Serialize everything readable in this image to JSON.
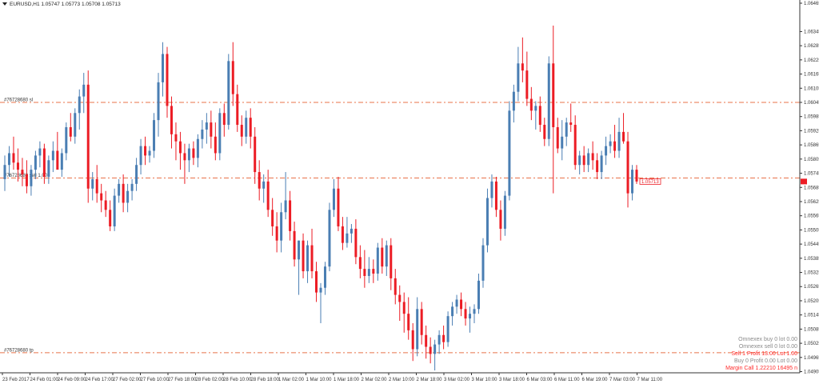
{
  "header": {
    "symbol_line": "EURUSD,H1  1.05747 1.05773 1.05708 1.05713"
  },
  "colors": {
    "bull": "#4a7eb3",
    "bear": "#ec1c24",
    "level_line": "#e8734a",
    "axis": "#333333",
    "price_box": "#ec1c24"
  },
  "chart_data": {
    "type": "candlestick",
    "y_axis": {
      "min": 1.049,
      "max": 1.06465,
      "ticks": [
        "1.06465",
        "1.06345",
        "1.06285",
        "1.06225",
        "1.06165",
        "1.06105",
        "1.06045",
        "1.05985",
        "1.05925",
        "1.05865",
        "1.05805",
        "1.05745",
        "1.05685",
        "1.05625",
        "1.05565",
        "1.05505",
        "1.05445",
        "1.05385",
        "1.05325",
        "1.05265",
        "1.05205",
        "1.05145",
        "1.05085",
        "1.05025",
        "1.04965",
        "1.04905"
      ]
    },
    "x_labels": [
      "23 Feb 2017",
      "24 Feb 01:00",
      "24 Feb 09:00",
      "24 Feb 17:00",
      "27 Feb 02:00",
      "27 Feb 10:00",
      "27 Feb 18:00",
      "28 Feb 02:00",
      "28 Feb 10:00",
      "28 Feb 18:00",
      "1 Mar 02:00",
      "1 Mar 10:00",
      "1 Mar 18:00",
      "2 Mar 02:00",
      "2 Mar 10:00",
      "2 Mar 18:00",
      "3 Mar 02:00",
      "3 Mar 10:00",
      "3 Mar 18:00",
      "6 Mar 03:00",
      "6 Mar 11:00",
      "6 Mar 19:00",
      "7 Mar 03:00",
      "7 Mar 11:00"
    ],
    "candles": [
      [
        1.0572,
        1.0582,
        1.0567,
        1.0578
      ],
      [
        1.0578,
        1.0586,
        1.0573,
        1.0583
      ],
      [
        1.0583,
        1.059,
        1.0576,
        1.0579
      ],
      [
        1.0579,
        1.0585,
        1.0571,
        1.0576
      ],
      [
        1.0576,
        1.0581,
        1.0569,
        1.0574
      ],
      [
        1.0574,
        1.058,
        1.0566,
        1.0569
      ],
      [
        1.0569,
        1.0578,
        1.0565,
        1.0576
      ],
      [
        1.0576,
        1.0584,
        1.0572,
        1.0582
      ],
      [
        1.0582,
        1.0588,
        1.0577,
        1.0585
      ],
      [
        1.0585,
        1.0587,
        1.057,
        1.0573
      ],
      [
        1.0573,
        1.0582,
        1.057,
        1.058
      ],
      [
        1.058,
        1.0588,
        1.0575,
        1.0584
      ],
      [
        1.0584,
        1.0592,
        1.0578,
        1.0576
      ],
      [
        1.0576,
        1.0585,
        1.0573,
        1.0583
      ],
      [
        1.0583,
        1.0596,
        1.058,
        1.0594
      ],
      [
        1.0594,
        1.06,
        1.0588,
        1.059
      ],
      [
        1.059,
        1.0602,
        1.0587,
        1.06
      ],
      [
        1.06,
        1.061,
        1.0593,
        1.0607
      ],
      [
        1.0607,
        1.0617,
        1.06,
        1.0612
      ],
      [
        1.0612,
        1.0618,
        1.0562,
        1.0568
      ],
      [
        1.0568,
        1.0575,
        1.0563,
        1.0572
      ],
      [
        1.0572,
        1.0578,
        1.0562,
        1.0566
      ],
      [
        1.0566,
        1.057,
        1.0558,
        1.0563
      ],
      [
        1.0563,
        1.0567,
        1.0556,
        1.0559
      ],
      [
        1.0559,
        1.0563,
        1.055,
        1.0552
      ],
      [
        1.0552,
        1.0568,
        1.055,
        1.0565
      ],
      [
        1.0565,
        1.0572,
        1.0562,
        1.057
      ],
      [
        1.057,
        1.0574,
        1.0558,
        1.0562
      ],
      [
        1.0562,
        1.057,
        1.0558,
        1.0567
      ],
      [
        1.0567,
        1.0572,
        1.0563,
        1.057
      ],
      [
        1.057,
        1.0581,
        1.0567,
        1.0578
      ],
      [
        1.0578,
        1.0589,
        1.0574,
        1.0586
      ],
      [
        1.0586,
        1.059,
        1.0578,
        1.0582
      ],
      [
        1.0582,
        1.0586,
        1.0579,
        1.0584
      ],
      [
        1.0584,
        1.06,
        1.0581,
        1.0597
      ],
      [
        1.0597,
        1.0617,
        1.059,
        1.0613
      ],
      [
        1.0613,
        1.063,
        1.0607,
        1.0625
      ],
      [
        1.0625,
        1.0628,
        1.0598,
        1.0603
      ],
      [
        1.0603,
        1.0607,
        1.0585,
        1.0591
      ],
      [
        1.0591,
        1.0596,
        1.058,
        1.0588
      ],
      [
        1.0588,
        1.0592,
        1.0576,
        1.0583
      ],
      [
        1.0583,
        1.0587,
        1.057,
        1.058
      ],
      [
        1.058,
        1.0587,
        1.0575,
        1.0585
      ],
      [
        1.0585,
        1.0588,
        1.0578,
        1.0581
      ],
      [
        1.0581,
        1.0591,
        1.0577,
        1.0589
      ],
      [
        1.0589,
        1.0597,
        1.0585,
        1.0593
      ],
      [
        1.0593,
        1.06,
        1.0587,
        1.0596
      ],
      [
        1.0596,
        1.0601,
        1.0585,
        1.059
      ],
      [
        1.059,
        1.0596,
        1.058,
        1.0583
      ],
      [
        1.0583,
        1.0602,
        1.058,
        1.06
      ],
      [
        1.06,
        1.0604,
        1.059,
        1.0595
      ],
      [
        1.0595,
        1.0625,
        1.0593,
        1.0622
      ],
      [
        1.0622,
        1.063,
        1.0603,
        1.0608
      ],
      [
        1.0608,
        1.0612,
        1.0592,
        1.0595
      ],
      [
        1.0595,
        1.0599,
        1.0586,
        1.059
      ],
      [
        1.059,
        1.0601,
        1.0587,
        1.0598
      ],
      [
        1.0598,
        1.0602,
        1.0585,
        1.059
      ],
      [
        1.059,
        1.0594,
        1.057,
        1.0575
      ],
      [
        1.0575,
        1.058,
        1.0563,
        1.0568
      ],
      [
        1.0568,
        1.0574,
        1.0562,
        1.0571
      ],
      [
        1.0571,
        1.0576,
        1.0556,
        1.0559
      ],
      [
        1.0559,
        1.0564,
        1.0548,
        1.0552
      ],
      [
        1.0552,
        1.0558,
        1.0541,
        1.0546
      ],
      [
        1.0546,
        1.0562,
        1.0541,
        1.0558
      ],
      [
        1.0558,
        1.0575,
        1.0555,
        1.0563
      ],
      [
        1.0563,
        1.0567,
        1.0546,
        1.055
      ],
      [
        1.055,
        1.0554,
        1.0535,
        1.0538
      ],
      [
        1.0538,
        1.0546,
        1.0523,
        1.0546
      ],
      [
        1.0546,
        1.0549,
        1.053,
        1.0533
      ],
      [
        1.0533,
        1.0546,
        1.0528,
        1.0544
      ],
      [
        1.0544,
        1.0551,
        1.053,
        1.0533
      ],
      [
        1.0533,
        1.0537,
        1.052,
        1.0524
      ],
      [
        1.0524,
        1.0528,
        1.0511,
        1.0526
      ],
      [
        1.0526,
        1.0537,
        1.0523,
        1.0535
      ],
      [
        1.0535,
        1.0562,
        1.0533,
        1.0559
      ],
      [
        1.0559,
        1.0572,
        1.0556,
        1.0568
      ],
      [
        1.0568,
        1.0573,
        1.055,
        1.0552
      ],
      [
        1.0552,
        1.0556,
        1.0542,
        1.0545
      ],
      [
        1.0545,
        1.0556,
        1.0543,
        1.0549
      ],
      [
        1.0549,
        1.0553,
        1.0545,
        1.0551
      ],
      [
        1.0551,
        1.0555,
        1.0536,
        1.0539
      ],
      [
        1.0539,
        1.0544,
        1.053,
        1.0534
      ],
      [
        1.0534,
        1.0542,
        1.0526,
        1.0531
      ],
      [
        1.0531,
        1.0539,
        1.0528,
        1.0534
      ],
      [
        1.0534,
        1.0538,
        1.0528,
        1.0532
      ],
      [
        1.0532,
        1.0545,
        1.0529,
        1.0543
      ],
      [
        1.0543,
        1.0547,
        1.0532,
        1.0535
      ],
      [
        1.0535,
        1.0546,
        1.0531,
        1.0544
      ],
      [
        1.0544,
        1.0547,
        1.0525,
        1.053
      ],
      [
        1.053,
        1.0534,
        1.0519,
        1.0523
      ],
      [
        1.0523,
        1.0527,
        1.0512,
        1.052
      ],
      [
        1.052,
        1.0524,
        1.0507,
        1.0515
      ],
      [
        1.0515,
        1.0522,
        1.0504,
        1.0508
      ],
      [
        1.0508,
        1.0511,
        1.0495,
        1.05
      ],
      [
        1.05,
        1.0522,
        1.0497,
        1.0517
      ],
      [
        1.0517,
        1.052,
        1.0502,
        1.0506
      ],
      [
        1.0506,
        1.051,
        1.0496,
        1.0501
      ],
      [
        1.0501,
        1.0505,
        1.0494,
        1.0498
      ],
      [
        1.0498,
        1.0504,
        1.0491,
        1.0502
      ],
      [
        1.0502,
        1.0508,
        1.0498,
        1.0506
      ],
      [
        1.0506,
        1.051,
        1.05,
        1.0503
      ],
      [
        1.0503,
        1.0516,
        1.0501,
        1.0514
      ],
      [
        1.0514,
        1.052,
        1.051,
        1.0518
      ],
      [
        1.0518,
        1.0523,
        1.0515,
        1.0521
      ],
      [
        1.0521,
        1.0524,
        1.0514,
        1.0517
      ],
      [
        1.0517,
        1.052,
        1.051,
        1.0513
      ],
      [
        1.0513,
        1.0518,
        1.0507,
        1.0515
      ],
      [
        1.0515,
        1.0519,
        1.0511,
        1.0517
      ],
      [
        1.0517,
        1.0532,
        1.0515,
        1.0529
      ],
      [
        1.0529,
        1.0547,
        1.0526,
        1.0544
      ],
      [
        1.0544,
        1.0568,
        1.0541,
        1.0564
      ],
      [
        1.0564,
        1.0574,
        1.056,
        1.0571
      ],
      [
        1.0571,
        1.0573,
        1.0556,
        1.0559
      ],
      [
        1.0559,
        1.0563,
        1.0546,
        1.0551
      ],
      [
        1.0551,
        1.0567,
        1.0548,
        1.0565
      ],
      [
        1.0565,
        1.0605,
        1.0563,
        1.0601
      ],
      [
        1.0601,
        1.0612,
        1.0596,
        1.0609
      ],
      [
        1.0609,
        1.0628,
        1.0605,
        1.0621
      ],
      [
        1.0621,
        1.0632,
        1.0613,
        1.0618
      ],
      [
        1.0618,
        1.0626,
        1.0603,
        1.0606
      ],
      [
        1.0606,
        1.0611,
        1.0597,
        1.0601
      ],
      [
        1.0601,
        1.0605,
        1.0593,
        1.0603
      ],
      [
        1.0603,
        1.0607,
        1.0592,
        1.0595
      ],
      [
        1.0595,
        1.0598,
        1.0586,
        1.0589
      ],
      [
        1.0589,
        1.0624,
        1.0586,
        1.0621
      ],
      [
        1.0621,
        1.0637,
        1.0566,
        1.0594
      ],
      [
        1.0594,
        1.0598,
        1.0583,
        1.0585
      ],
      [
        1.0585,
        1.0597,
        1.058,
        1.059
      ],
      [
        1.059,
        1.0598,
        1.0586,
        1.0596
      ],
      [
        1.0596,
        1.0604,
        1.0592,
        1.0595
      ],
      [
        1.0595,
        1.0599,
        1.0576,
        1.0578
      ],
      [
        1.0578,
        1.0584,
        1.0574,
        1.0582
      ],
      [
        1.0582,
        1.0586,
        1.0575,
        1.0578
      ],
      [
        1.0578,
        1.0585,
        1.0575,
        1.0583
      ],
      [
        1.0583,
        1.0588,
        1.0576,
        1.058
      ],
      [
        1.058,
        1.0583,
        1.0572,
        1.0575
      ],
      [
        1.0575,
        1.0584,
        1.0572,
        1.0582
      ],
      [
        1.0582,
        1.059,
        1.0578,
        1.0586
      ],
      [
        1.0586,
        1.0591,
        1.0583,
        1.0588
      ],
      [
        1.0588,
        1.0595,
        1.0581,
        1.0584
      ],
      [
        1.0584,
        1.0598,
        1.0581,
        1.0592
      ],
      [
        1.0592,
        1.06,
        1.0587,
        1.0588
      ],
      [
        1.0588,
        1.0592,
        1.056,
        1.0566
      ],
      [
        1.0566,
        1.0578,
        1.0563,
        1.0576
      ],
      [
        1.0576,
        1.0578,
        1.057,
        1.0571
      ]
    ]
  },
  "levels": [
    {
      "label": "#76728680 sl",
      "price": 1.06045
    },
    {
      "label": "#76728680 sell 1.00",
      "price": 1.05725
    },
    {
      "label": "#76728680 tp",
      "price": 1.04985
    }
  ],
  "current_price_label": "1.05713",
  "info_panel": {
    "ommexex_buy": "Omnexex buy 0    lot 0.00",
    "ommexex_sell": "Omnexex sell 0    lot 0.00",
    "sell_line": "Sell 1   Profit 13.00   Lot 1.00",
    "buy_line": "Buy 0   Profit 0.00   Lot 0.00",
    "margin_line": "Margin Call 1.22210    16495 n"
  }
}
